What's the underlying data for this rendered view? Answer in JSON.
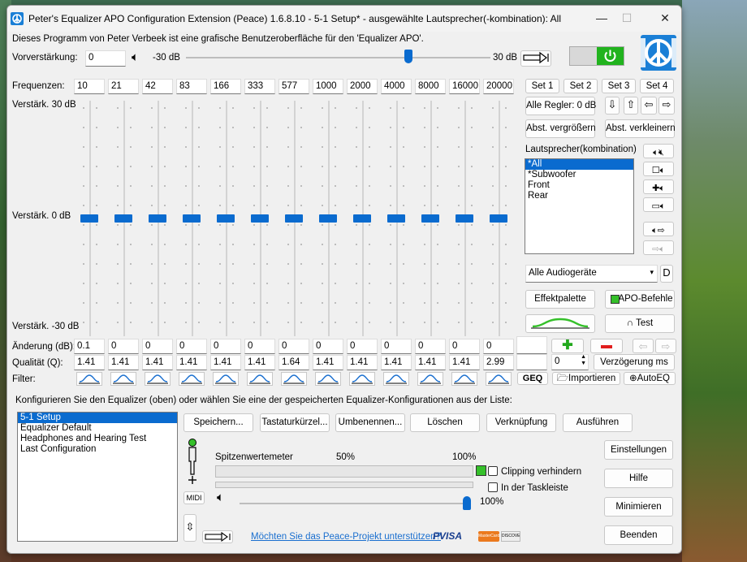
{
  "window": {
    "title": "Peter's Equalizer APO Configuration Extension (Peace) 1.6.8.10 - 5-1 Setup* - ausgewählte Lautsprecher(-kombination): All"
  },
  "intro": "Dieses Programm von Peter Verbeek ist eine grafische Benutzeroberfläche für den 'Equalizer APO'.",
  "preamp": {
    "label": "Vorverstärkung:",
    "value": "0",
    "min": "-30 dB",
    "max": "30 dB",
    "level": 0.73
  },
  "eq": {
    "freq_label": "Frequenzen:",
    "frequencies": [
      "10",
      "21",
      "42",
      "83",
      "166",
      "333",
      "577",
      "1000",
      "2000",
      "4000",
      "8000",
      "16000",
      "20000"
    ],
    "gain_top": "Verstärk. 30 dB",
    "gain_mid": "Verstärk. 0 dB",
    "gain_bottom": "Verstärk. -30 dB",
    "gains": [
      0,
      0,
      0,
      0,
      0,
      0,
      0,
      0,
      0,
      0,
      0,
      0,
      0
    ],
    "change_label": "Änderung (dB):",
    "changes": [
      "0.1",
      "0",
      "0",
      "0",
      "0",
      "0",
      "0",
      "0",
      "0",
      "0",
      "0",
      "0",
      "0"
    ],
    "q_label": "Qualität (Q):",
    "qualities": [
      "1.41",
      "1.41",
      "1.41",
      "1.41",
      "1.41",
      "1.41",
      "1.64",
      "1.41",
      "1.41",
      "1.41",
      "1.41",
      "1.41",
      "2.99"
    ],
    "filter_label": "Filter:"
  },
  "right": {
    "sets": [
      "Set 1",
      "Set 2",
      "Set 3",
      "Set 4"
    ],
    "all_regler": "Alle Regler: 0 dB",
    "abst_vergr": "Abst. vergrößern",
    "abst_verkl": "Abst. verkleinern",
    "speakers_label": "Lautsprecher(kombination) au",
    "speakers": [
      "*All",
      "*Subwoofer",
      "Front",
      "Rear"
    ],
    "device": "Alle Audiogeräte",
    "device_d": "D",
    "effektpalette": "Effektpalette",
    "apo_befehle": "APO-Befehle",
    "test": "Test",
    "delay_value": "0",
    "verzoegerung": "Verzögerung ms",
    "geq": "GEQ",
    "importieren": "Importieren",
    "autoeq": "AutoEQ"
  },
  "config": {
    "label": "Konfigurieren Sie den Equalizer (oben) oder wählen Sie eine der gespeicherten Equalizer-Konfigurationen aus der Liste:",
    "items": [
      "5-1 Setup",
      "Equalizer Default",
      "Headphones and Hearing Test",
      "Last Configuration"
    ],
    "buttons": [
      "Speichern...",
      "Tastaturkürzel...",
      "Umbenennen...",
      "Löschen",
      "Verknüpfung",
      "Ausführen"
    ]
  },
  "meter": {
    "label": "Spitzenwertemeter",
    "p50": "50%",
    "p100": "100%",
    "clipping": "Clipping verhindern",
    "taskleiste": "In der Taskleiste",
    "volume": "100%",
    "midi": "MIDI"
  },
  "support": "Möchten Sie das Peace-Projekt unterstützen?",
  "payment": {
    "paypal": "PVISA",
    "mc": "MasterCard",
    "disc": "DISCOVER"
  },
  "side_buttons": [
    "Einstellungen",
    "Hilfe",
    "Minimieren",
    "Beenden"
  ],
  "colors": {
    "accent": "#0a6bcf",
    "power": "#21b31e",
    "green": "#35c02a",
    "red": "#e11d1d"
  }
}
